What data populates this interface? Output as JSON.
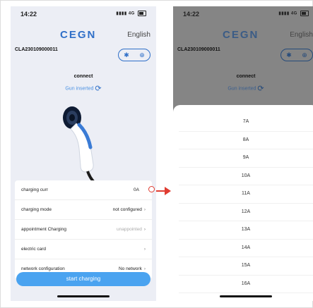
{
  "left": {
    "time": "14:22",
    "network": "4G",
    "brand": "CEGN",
    "language": "English",
    "device_id": "CLA230109000011",
    "state": "connect",
    "substate": "Gun inserted",
    "settings": [
      {
        "label": "charging curr",
        "value": "0A"
      },
      {
        "label": "charging mode",
        "value": "not configured"
      },
      {
        "label": "appointment Charging",
        "value": "unappointed"
      },
      {
        "label": "electric card",
        "value": ""
      },
      {
        "label": "network configuration",
        "value": "No network"
      }
    ],
    "start_label": "start charging"
  },
  "right": {
    "time": "14:22",
    "network": "4G",
    "brand": "CEGN",
    "language": "English",
    "device_id": "CLA230109000011",
    "state": "connect",
    "substate": "Gun inserted",
    "options": [
      "7A",
      "8A",
      "9A",
      "10A",
      "11A",
      "12A",
      "13A",
      "14A",
      "15A",
      "16A"
    ]
  },
  "colors": {
    "accent": "#2f6fc8",
    "button": "#4aa3f0",
    "annotation": "#e03c31"
  },
  "icons": [
    "bluetooth-icon",
    "globe-icon",
    "refresh-icon",
    "chevron-right-icon",
    "charging-plug-icon"
  ]
}
